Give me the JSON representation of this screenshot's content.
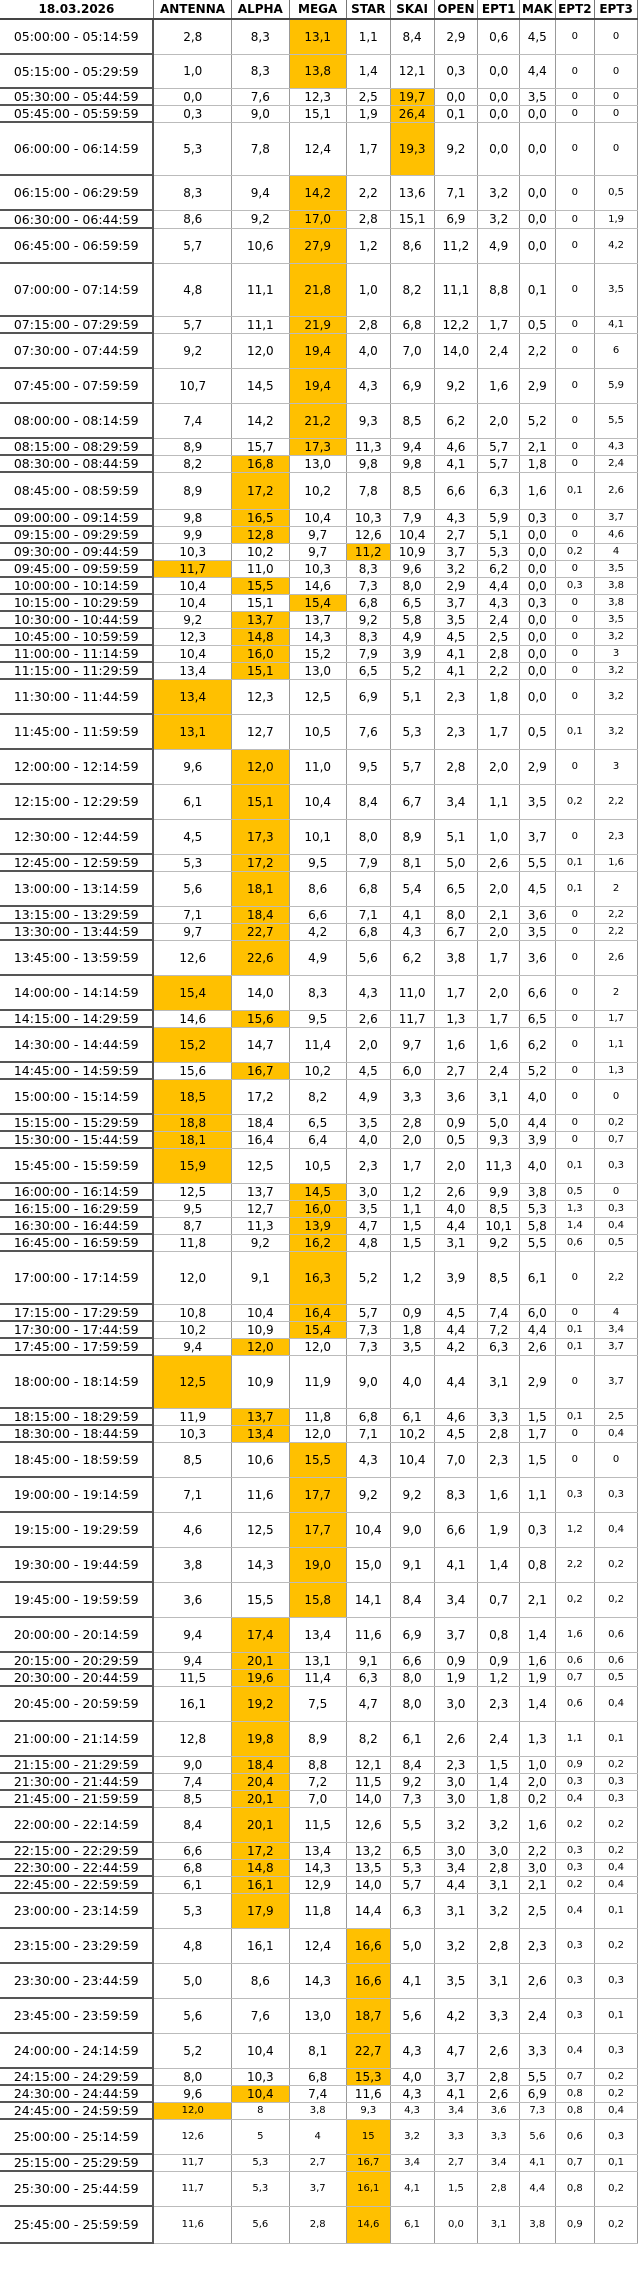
{
  "date": "18.03.2026",
  "columns": [
    "ANTENNA",
    "ALPHA",
    "MEGA",
    "STAR",
    "SKAI",
    "OPEN",
    "EPT1",
    "MAK",
    "EPT2",
    "EPT3"
  ],
  "highlight_color": "#ffc000",
  "rows": [
    [
      "05:00:00 - 05:14:59",
      "2,8",
      "8,3",
      "13,1",
      "1,1",
      "8,4",
      "2,9",
      "0,6",
      "4,5",
      "0",
      "0"
    ],
    [
      "05:15:00 - 05:29:59",
      "1,0",
      "8,3",
      "13,8",
      "1,4",
      "12,1",
      "0,3",
      "0,0",
      "4,4",
      "0",
      "0"
    ],
    [
      "05:30:00 - 05:44:59",
      "0,0",
      "7,6",
      "12,3",
      "2,5",
      "19,7",
      "0,0",
      "0,0",
      "3,5",
      "0",
      "0"
    ],
    [
      "05:45:00 - 05:59:59",
      "0,3",
      "9,0",
      "15,1",
      "1,9",
      "26,4",
      "0,1",
      "0,0",
      "0,0",
      "0",
      "0"
    ],
    [
      "06:00:00 - 06:14:59",
      "5,3",
      "7,8",
      "12,4",
      "1,7",
      "19,3",
      "9,2",
      "0,0",
      "0,0",
      "0",
      "0"
    ],
    [
      "06:15:00 - 06:29:59",
      "8,3",
      "9,4",
      "14,2",
      "2,2",
      "13,6",
      "7,1",
      "3,2",
      "0,0",
      "0",
      "0,5"
    ],
    [
      "06:30:00 - 06:44:59",
      "8,6",
      "9,2",
      "17,0",
      "2,8",
      "15,1",
      "6,9",
      "3,2",
      "0,0",
      "0",
      "1,9"
    ],
    [
      "06:45:00 - 06:59:59",
      "5,7",
      "10,6",
      "27,9",
      "1,2",
      "8,6",
      "11,2",
      "4,9",
      "0,0",
      "0",
      "4,2"
    ],
    [
      "07:00:00 - 07:14:59",
      "4,8",
      "11,1",
      "21,8",
      "1,0",
      "8,2",
      "11,1",
      "8,8",
      "0,1",
      "0",
      "3,5"
    ],
    [
      "07:15:00 - 07:29:59",
      "5,7",
      "11,1",
      "21,9",
      "2,8",
      "6,8",
      "12,2",
      "1,7",
      "0,5",
      "0",
      "4,1"
    ],
    [
      "07:30:00 - 07:44:59",
      "9,2",
      "12,0",
      "19,4",
      "4,0",
      "7,0",
      "14,0",
      "2,4",
      "2,2",
      "0",
      "6"
    ],
    [
      "07:45:00 - 07:59:59",
      "10,7",
      "14,5",
      "19,4",
      "4,3",
      "6,9",
      "9,2",
      "1,6",
      "2,9",
      "0",
      "5,9"
    ],
    [
      "08:00:00 - 08:14:59",
      "7,4",
      "14,2",
      "21,2",
      "9,3",
      "8,5",
      "6,2",
      "2,0",
      "5,2",
      "0",
      "5,5"
    ],
    [
      "08:15:00 - 08:29:59",
      "8,9",
      "15,7",
      "17,3",
      "11,3",
      "9,4",
      "4,6",
      "5,7",
      "2,1",
      "0",
      "4,3"
    ],
    [
      "08:30:00 - 08:44:59",
      "8,2",
      "16,8",
      "13,0",
      "9,8",
      "9,8",
      "4,1",
      "5,7",
      "1,8",
      "0",
      "2,4"
    ],
    [
      "08:45:00 - 08:59:59",
      "8,9",
      "17,2",
      "10,2",
      "7,8",
      "8,5",
      "6,6",
      "6,3",
      "1,6",
      "0,1",
      "2,6"
    ],
    [
      "09:00:00 - 09:14:59",
      "9,8",
      "16,5",
      "10,4",
      "10,3",
      "7,9",
      "4,3",
      "5,9",
      "0,3",
      "0",
      "3,7"
    ],
    [
      "09:15:00 - 09:29:59",
      "9,9",
      "12,8",
      "9,7",
      "12,6",
      "10,4",
      "2,7",
      "5,1",
      "0,0",
      "0",
      "4,6"
    ],
    [
      "09:30:00 - 09:44:59",
      "10,3",
      "10,2",
      "9,7",
      "11,2",
      "10,9",
      "3,7",
      "5,3",
      "0,0",
      "0,2",
      "4"
    ],
    [
      "09:45:00 - 09:59:59",
      "11,7",
      "11,0",
      "10,3",
      "8,3",
      "9,6",
      "3,2",
      "6,2",
      "0,0",
      "0",
      "3,5"
    ],
    [
      "10:00:00 - 10:14:59",
      "10,4",
      "15,5",
      "14,6",
      "7,3",
      "8,0",
      "2,9",
      "4,4",
      "0,0",
      "0,3",
      "3,8"
    ],
    [
      "10:15:00 - 10:29:59",
      "10,4",
      "15,1",
      "15,4",
      "6,8",
      "6,5",
      "3,7",
      "4,3",
      "0,3",
      "0",
      "3,8"
    ],
    [
      "10:30:00 - 10:44:59",
      "9,2",
      "13,7",
      "13,7",
      "9,2",
      "5,8",
      "3,5",
      "2,4",
      "0,0",
      "0",
      "3,5"
    ],
    [
      "10:45:00 - 10:59:59",
      "12,3",
      "14,8",
      "14,3",
      "8,3",
      "4,9",
      "4,5",
      "2,5",
      "0,0",
      "0",
      "3,2"
    ],
    [
      "11:00:00 - 11:14:59",
      "10,4",
      "16,0",
      "15,2",
      "7,9",
      "3,9",
      "4,1",
      "2,8",
      "0,0",
      "0",
      "3"
    ],
    [
      "11:15:00 - 11:29:59",
      "13,4",
      "15,1",
      "13,0",
      "6,5",
      "5,2",
      "4,1",
      "2,2",
      "0,0",
      "0",
      "3,2"
    ],
    [
      "11:30:00 - 11:44:59",
      "13,4",
      "12,3",
      "12,5",
      "6,9",
      "5,1",
      "2,3",
      "1,8",
      "0,0",
      "0",
      "3,2"
    ],
    [
      "11:45:00 - 11:59:59",
      "13,1",
      "12,7",
      "10,5",
      "7,6",
      "5,3",
      "2,3",
      "1,7",
      "0,5",
      "0,1",
      "3,2"
    ],
    [
      "12:00:00 - 12:14:59",
      "9,6",
      "12,0",
      "11,0",
      "9,5",
      "5,7",
      "2,8",
      "2,0",
      "2,9",
      "0",
      "3"
    ],
    [
      "12:15:00 - 12:29:59",
      "6,1",
      "15,1",
      "10,4",
      "8,4",
      "6,7",
      "3,4",
      "1,1",
      "3,5",
      "0,2",
      "2,2"
    ],
    [
      "12:30:00 - 12:44:59",
      "4,5",
      "17,3",
      "10,1",
      "8,0",
      "8,9",
      "5,1",
      "1,0",
      "3,7",
      "0",
      "2,3"
    ],
    [
      "12:45:00 - 12:59:59",
      "5,3",
      "17,2",
      "9,5",
      "7,9",
      "8,1",
      "5,0",
      "2,6",
      "5,5",
      "0,1",
      "1,6"
    ],
    [
      "13:00:00 - 13:14:59",
      "5,6",
      "18,1",
      "8,6",
      "6,8",
      "5,4",
      "6,5",
      "2,0",
      "4,5",
      "0,1",
      "2"
    ],
    [
      "13:15:00 - 13:29:59",
      "7,1",
      "18,4",
      "6,6",
      "7,1",
      "4,1",
      "8,0",
      "2,1",
      "3,6",
      "0",
      "2,2"
    ],
    [
      "13:30:00 - 13:44:59",
      "9,7",
      "22,7",
      "4,2",
      "6,8",
      "4,3",
      "6,7",
      "2,0",
      "3,5",
      "0",
      "2,2"
    ],
    [
      "13:45:00 - 13:59:59",
      "12,6",
      "22,6",
      "4,9",
      "5,6",
      "6,2",
      "3,8",
      "1,7",
      "3,6",
      "0",
      "2,6"
    ],
    [
      "14:00:00 - 14:14:59",
      "15,4",
      "14,0",
      "8,3",
      "4,3",
      "11,0",
      "1,7",
      "2,0",
      "6,6",
      "0",
      "2"
    ],
    [
      "14:15:00 - 14:29:59",
      "14,6",
      "15,6",
      "9,5",
      "2,6",
      "11,7",
      "1,3",
      "1,7",
      "6,5",
      "0",
      "1,7"
    ],
    [
      "14:30:00 - 14:44:59",
      "15,2",
      "14,7",
      "11,4",
      "2,0",
      "9,7",
      "1,6",
      "1,6",
      "6,2",
      "0",
      "1,1"
    ],
    [
      "14:45:00 - 14:59:59",
      "15,6",
      "16,7",
      "10,2",
      "4,5",
      "6,0",
      "2,7",
      "2,4",
      "5,2",
      "0",
      "1,3"
    ],
    [
      "15:00:00 - 15:14:59",
      "18,5",
      "17,2",
      "8,2",
      "4,9",
      "3,3",
      "3,6",
      "3,1",
      "4,0",
      "0",
      "0"
    ],
    [
      "15:15:00 - 15:29:59",
      "18,8",
      "18,4",
      "6,5",
      "3,5",
      "2,8",
      "0,9",
      "5,0",
      "4,4",
      "0",
      "0,2"
    ],
    [
      "15:30:00 - 15:44:59",
      "18,1",
      "16,4",
      "6,4",
      "4,0",
      "2,0",
      "0,5",
      "9,3",
      "3,9",
      "0",
      "0,7"
    ],
    [
      "15:45:00 - 15:59:59",
      "15,9",
      "12,5",
      "10,5",
      "2,3",
      "1,7",
      "2,0",
      "11,3",
      "4,0",
      "0,1",
      "0,3"
    ],
    [
      "16:00:00 - 16:14:59",
      "12,5",
      "13,7",
      "14,5",
      "3,0",
      "1,2",
      "2,6",
      "9,9",
      "3,8",
      "0,5",
      "0"
    ],
    [
      "16:15:00 - 16:29:59",
      "9,5",
      "12,7",
      "16,0",
      "3,5",
      "1,1",
      "4,0",
      "8,5",
      "5,3",
      "1,3",
      "0,3"
    ],
    [
      "16:30:00 - 16:44:59",
      "8,7",
      "11,3",
      "13,9",
      "4,7",
      "1,5",
      "4,4",
      "10,1",
      "5,8",
      "1,4",
      "0,4"
    ],
    [
      "16:45:00 - 16:59:59",
      "11,8",
      "9,2",
      "16,2",
      "4,8",
      "1,5",
      "3,1",
      "9,2",
      "5,5",
      "0,6",
      "0,5"
    ],
    [
      "17:00:00 - 17:14:59",
      "12,0",
      "9,1",
      "16,3",
      "5,2",
      "1,2",
      "3,9",
      "8,5",
      "6,1",
      "0",
      "2,2"
    ],
    [
      "17:15:00 - 17:29:59",
      "10,8",
      "10,4",
      "16,4",
      "5,7",
      "0,9",
      "4,5",
      "7,4",
      "6,0",
      "0",
      "4"
    ],
    [
      "17:30:00 - 17:44:59",
      "10,2",
      "10,9",
      "15,4",
      "7,3",
      "1,8",
      "4,4",
      "7,2",
      "4,4",
      "0,1",
      "3,4"
    ],
    [
      "17:45:00 - 17:59:59",
      "9,4",
      "12,0",
      "12,0",
      "7,3",
      "3,5",
      "4,2",
      "6,3",
      "2,6",
      "0,1",
      "3,7"
    ],
    [
      "18:00:00 - 18:14:59",
      "12,5",
      "10,9",
      "11,9",
      "9,0",
      "4,0",
      "4,4",
      "3,1",
      "2,9",
      "0",
      "3,7"
    ],
    [
      "18:15:00 - 18:29:59",
      "11,9",
      "13,7",
      "11,8",
      "6,8",
      "6,1",
      "4,6",
      "3,3",
      "1,5",
      "0,1",
      "2,5"
    ],
    [
      "18:30:00 - 18:44:59",
      "10,3",
      "13,4",
      "12,0",
      "7,1",
      "10,2",
      "4,5",
      "2,8",
      "1,7",
      "0",
      "0,4"
    ],
    [
      "18:45:00 - 18:59:59",
      "8,5",
      "10,6",
      "15,5",
      "4,3",
      "10,4",
      "7,0",
      "2,3",
      "1,5",
      "0",
      "0"
    ],
    [
      "19:00:00 - 19:14:59",
      "7,1",
      "11,6",
      "17,7",
      "9,2",
      "9,2",
      "8,3",
      "1,6",
      "1,1",
      "0,3",
      "0,3"
    ],
    [
      "19:15:00 - 19:29:59",
      "4,6",
      "12,5",
      "17,7",
      "10,4",
      "9,0",
      "6,6",
      "1,9",
      "0,3",
      "1,2",
      "0,4"
    ],
    [
      "19:30:00 - 19:44:59",
      "3,8",
      "14,3",
      "19,0",
      "15,0",
      "9,1",
      "4,1",
      "1,4",
      "0,8",
      "2,2",
      "0,2"
    ],
    [
      "19:45:00 - 19:59:59",
      "3,6",
      "15,5",
      "15,8",
      "14,1",
      "8,4",
      "3,4",
      "0,7",
      "2,1",
      "0,2",
      "0,2"
    ],
    [
      "20:00:00 - 20:14:59",
      "9,4",
      "17,4",
      "13,4",
      "11,6",
      "6,9",
      "3,7",
      "0,8",
      "1,4",
      "1,6",
      "0,6"
    ],
    [
      "20:15:00 - 20:29:59",
      "9,4",
      "20,1",
      "13,1",
      "9,1",
      "6,6",
      "0,9",
      "0,9",
      "1,6",
      "0,6",
      "0,6"
    ],
    [
      "20:30:00 - 20:44:59",
      "11,5",
      "19,6",
      "11,4",
      "6,3",
      "8,0",
      "1,9",
      "1,2",
      "1,9",
      "0,7",
      "0,5"
    ],
    [
      "20:45:00 - 20:59:59",
      "16,1",
      "19,2",
      "7,5",
      "4,7",
      "8,0",
      "3,0",
      "2,3",
      "1,4",
      "0,6",
      "0,4"
    ],
    [
      "21:00:00 - 21:14:59",
      "12,8",
      "19,8",
      "8,9",
      "8,2",
      "6,1",
      "2,6",
      "2,4",
      "1,3",
      "1,1",
      "0,1"
    ],
    [
      "21:15:00 - 21:29:59",
      "9,0",
      "18,4",
      "8,8",
      "12,1",
      "8,4",
      "2,3",
      "1,5",
      "1,0",
      "0,9",
      "0,2"
    ],
    [
      "21:30:00 - 21:44:59",
      "7,4",
      "20,4",
      "7,2",
      "11,5",
      "9,2",
      "3,0",
      "1,4",
      "2,0",
      "0,3",
      "0,3"
    ],
    [
      "21:45:00 - 21:59:59",
      "8,5",
      "20,1",
      "7,0",
      "14,0",
      "7,3",
      "3,0",
      "1,8",
      "0,2",
      "0,4",
      "0,3"
    ],
    [
      "22:00:00 - 22:14:59",
      "8,4",
      "20,1",
      "11,5",
      "12,6",
      "5,5",
      "3,2",
      "3,2",
      "1,6",
      "0,2",
      "0,2"
    ],
    [
      "22:15:00 - 22:29:59",
      "6,6",
      "17,2",
      "13,4",
      "13,2",
      "6,5",
      "3,0",
      "3,0",
      "2,2",
      "0,3",
      "0,2"
    ],
    [
      "22:30:00 - 22:44:59",
      "6,8",
      "14,8",
      "14,3",
      "13,5",
      "5,3",
      "3,4",
      "2,8",
      "3,0",
      "0,3",
      "0,4"
    ],
    [
      "22:45:00 - 22:59:59",
      "6,1",
      "16,1",
      "12,9",
      "14,0",
      "5,7",
      "4,4",
      "3,1",
      "2,1",
      "0,2",
      "0,4"
    ],
    [
      "23:00:00 - 23:14:59",
      "5,3",
      "17,9",
      "11,8",
      "14,4",
      "6,3",
      "3,1",
      "3,2",
      "2,5",
      "0,4",
      "0,1"
    ],
    [
      "23:15:00 - 23:29:59",
      "4,8",
      "16,1",
      "12,4",
      "16,6",
      "5,0",
      "3,2",
      "2,8",
      "2,3",
      "0,3",
      "0,2"
    ],
    [
      "23:30:00 - 23:44:59",
      "5,0",
      "8,6",
      "14,3",
      "16,6",
      "4,1",
      "3,5",
      "3,1",
      "2,6",
      "0,3",
      "0,3"
    ],
    [
      "23:45:00 - 23:59:59",
      "5,6",
      "7,6",
      "13,0",
      "18,7",
      "5,6",
      "4,2",
      "3,3",
      "2,4",
      "0,3",
      "0,1"
    ],
    [
      "24:00:00 - 24:14:59",
      "5,2",
      "10,4",
      "8,1",
      "22,7",
      "4,3",
      "4,7",
      "2,6",
      "3,3",
      "0,4",
      "0,3"
    ],
    [
      "24:15:00 - 24:29:59",
      "8,0",
      "10,3",
      "6,8",
      "15,3",
      "4,0",
      "3,7",
      "2,8",
      "5,5",
      "0,7",
      "0,2"
    ],
    [
      "24:30:00 - 24:44:59",
      "9,6",
      "10,4",
      "7,4",
      "11,6",
      "4,3",
      "4,1",
      "2,6",
      "6,9",
      "0,8",
      "0,2"
    ],
    [
      "24:45:00 - 24:59:59",
      "12,0",
      "8",
      "3,8",
      "9,3",
      "4,3",
      "3,4",
      "3,6",
      "7,3",
      "0,8",
      "0,4"
    ],
    [
      "25:00:00 - 25:14:59",
      "12,6",
      "5",
      "4",
      "15",
      "3,2",
      "3,3",
      "3,3",
      "5,6",
      "0,6",
      "0,3"
    ],
    [
      "25:15:00 - 25:29:59",
      "11,7",
      "5,3",
      "2,7",
      "16,7",
      "3,4",
      "2,7",
      "3,4",
      "4,1",
      "0,7",
      "0,1"
    ],
    [
      "25:30:00 - 25:44:59",
      "11,7",
      "5,3",
      "3,7",
      "16,1",
      "4,1",
      "1,5",
      "2,8",
      "4,4",
      "0,8",
      "0,2"
    ],
    [
      "25:45:00 - 25:59:59",
      "11,6",
      "5,6",
      "2,8",
      "14,6",
      "6,1",
      "0,0",
      "3,1",
      "3,8",
      "0,9",
      "0,2"
    ]
  ],
  "highlights": [
    [
      3
    ],
    [
      3
    ],
    [
      5
    ],
    [
      5
    ],
    [
      5
    ],
    [
      3
    ],
    [
      3
    ],
    [
      3
    ],
    [
      3
    ],
    [
      3
    ],
    [
      3
    ],
    [
      3
    ],
    [
      3
    ],
    [
      3
    ],
    [
      2
    ],
    [
      2
    ],
    [
      2
    ],
    [
      2
    ],
    [
      4
    ],
    [
      1
    ],
    [
      2
    ],
    [
      3
    ],
    [
      2
    ],
    [
      2
    ],
    [
      2
    ],
    [
      2
    ],
    [
      1
    ],
    [
      1
    ],
    [
      2
    ],
    [
      2
    ],
    [
      2
    ],
    [
      2
    ],
    [
      2
    ],
    [
      2
    ],
    [
      2
    ],
    [
      2
    ],
    [
      1
    ],
    [
      2
    ],
    [
      1
    ],
    [
      2
    ],
    [
      1
    ],
    [
      1
    ],
    [
      1
    ],
    [
      1
    ],
    [
      3
    ],
    [
      3
    ],
    [
      3
    ],
    [
      3
    ],
    [
      3
    ],
    [
      3
    ],
    [
      3
    ],
    [
      2
    ],
    [
      1
    ],
    [
      2
    ],
    [
      2
    ],
    [
      3
    ],
    [
      3
    ],
    [
      3
    ],
    [
      3
    ],
    [
      3
    ],
    [
      2
    ],
    [
      2
    ],
    [
      2
    ],
    [
      2
    ],
    [
      2
    ],
    [
      2
    ],
    [
      2
    ],
    [
      2
    ],
    [
      2
    ],
    [
      2
    ],
    [
      2
    ],
    [
      2
    ],
    [
      2
    ],
    [
      4
    ],
    [
      4
    ],
    [
      4
    ],
    [
      4
    ],
    [
      4
    ],
    [
      2
    ],
    [
      1
    ],
    [
      4
    ],
    [
      4
    ],
    [
      4
    ],
    [
      4
    ]
  ]
}
